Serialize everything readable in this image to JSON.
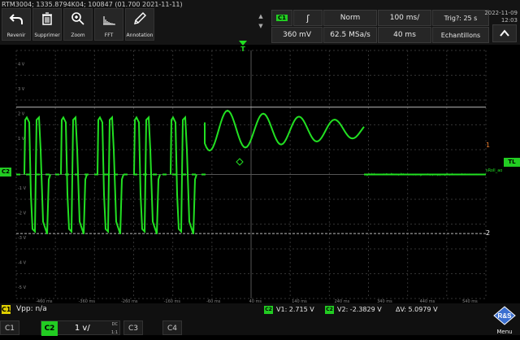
{
  "device_info": "RTM3004; 1335.8794K04; 100847 (01.700 2021-11-11)",
  "toolbar": {
    "undo": "Revenir",
    "delete": "Supprimer",
    "zoom": "Zoom",
    "fft": "FFT",
    "annotation": "Annotation"
  },
  "trigger_panel": {
    "channel": "C1",
    "edge_symbol": "ʃ",
    "mode": "Norm",
    "time_scale": "100 ms/",
    "trig_count": "Trig?: 25 s",
    "level": "360 mV",
    "sample_rate": "62.5 MSa/s",
    "record_time": "40 ms",
    "acq_mode": "Echantillons"
  },
  "datetime": {
    "date": "2022-11-09",
    "time": "12:03"
  },
  "waveform": {
    "color": "#22e022",
    "y_labels": [
      "4 V",
      "3 V",
      "2 V",
      "1 V",
      "",
      "-1 V",
      "-2 V",
      "-3 V",
      "-4 V",
      "-5 V"
    ],
    "x_labels": [
      "-460 ms",
      "-360 ms",
      "-260 ms",
      "-160 ms",
      "-60 ms",
      "40 ms",
      "140 ms",
      "240 ms",
      "340 ms",
      "440 ms",
      "540 ms"
    ],
    "channel_marker": "C2",
    "trigger_marker": "T",
    "cursor1_label": "1",
    "cursor2_label": "2",
    "tl_label": "TL",
    "cursor1_v": 2.715,
    "cursor2_v": -2.3829,
    "plot_annotation": "sRoll_ao"
  },
  "measurement": {
    "badge": "C1",
    "text": "Vpp: n/a",
    "v1_badge": "C2",
    "v1": "V1: 2.715 V",
    "v2_badge": "C2",
    "v2": "V2: -2.3829 V",
    "dv": "ΔV: 5.0979 V"
  },
  "channels": [
    {
      "label": "C1",
      "active": false
    },
    {
      "label": "C2",
      "active": true,
      "scale": "1 v/",
      "coupling": "DC",
      "extra": "1:1"
    },
    {
      "label": "C3",
      "active": false
    },
    {
      "label": "C4",
      "active": false
    }
  ],
  "menu_label": "Menu",
  "logo_text": "R&S"
}
